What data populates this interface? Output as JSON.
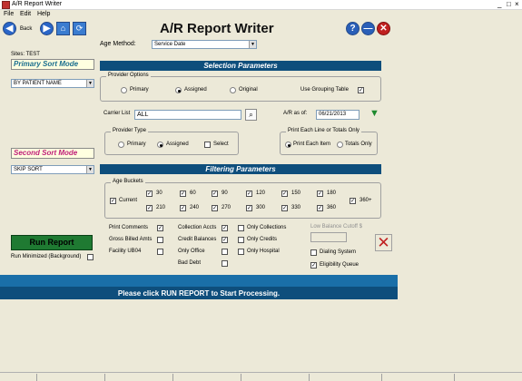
{
  "window": {
    "title": "A/R Report Writer",
    "minimize": "_",
    "maximize": "□",
    "close": "×"
  },
  "menu": [
    "File",
    "Edit",
    "Help"
  ],
  "toolbar": {
    "back_label": "Back",
    "page_title": "A/R Report Writer",
    "help_label": "?",
    "min_label": "—",
    "close_label": "✕"
  },
  "age_method": {
    "label": "Age Method:",
    "value": "Service Date"
  },
  "sites": "Sites: TEST",
  "primary_sort": {
    "title": "Primary Sort Mode",
    "value": "BY PATIENT NAME"
  },
  "second_sort": {
    "title": "Second Sort Mode",
    "value": "SKIP SORT"
  },
  "selection_header": "Selection Parameters",
  "provider_options": {
    "title": "Provider Options",
    "options": [
      "Primary",
      "Assigned",
      "Original"
    ],
    "selected": "Assigned",
    "grouping_label": "Use Grouping Table",
    "grouping_checked": true
  },
  "carrier": {
    "label": "Carrier List",
    "value": "ALL"
  },
  "ar_as_of": {
    "label": "A/R as of:",
    "value": "06/21/2013"
  },
  "provider_type": {
    "title": "Provider Type",
    "options": [
      "Primary",
      "Assigned"
    ],
    "selected": "Assigned",
    "select_label": "Select"
  },
  "print_each": {
    "title": "Print Each Line or Totals Only",
    "options": [
      "Print Each Item",
      "Totals Only"
    ],
    "selected": "Print Each Item"
  },
  "filtering_header": "Filtering Parameters",
  "age_buckets": {
    "title": "Age Buckets",
    "current": "Current",
    "row1": [
      "30",
      "60",
      "90",
      "120",
      "150",
      "180"
    ],
    "row2": [
      "210",
      "240",
      "270",
      "300",
      "330",
      "360"
    ],
    "extra": "360+"
  },
  "options_left": [
    {
      "label": "Print Comments",
      "checked": true
    },
    {
      "label": "Gross Billed Amts",
      "checked": false
    },
    {
      "label": "Facility UB04",
      "checked": false
    }
  ],
  "options_mid": [
    {
      "label": "Collection Accts",
      "checked": true
    },
    {
      "label": "Credit Balances",
      "checked": true
    },
    {
      "label": "Only Office",
      "checked": false
    },
    {
      "label": "Bad Debt",
      "checked": false
    }
  ],
  "options_right": [
    {
      "label": "Only Collections",
      "checked": false
    },
    {
      "label": "Only Credits",
      "checked": false
    },
    {
      "label": "Only Hospital",
      "checked": false
    }
  ],
  "low_balance": {
    "label": "Low Balance Cutoff $",
    "value": ""
  },
  "dialing": {
    "label": "Dialing System",
    "checked": false
  },
  "eligibility": {
    "label": "Eligibility Queue",
    "checked": true
  },
  "run_report": {
    "label": "Run Report",
    "minimized_label": "Run Minimized (Background)"
  },
  "bottom_message": "Please click RUN REPORT to Start Processing.",
  "colors": {
    "section_bar": "#0e4e7c",
    "run_button": "#1f7a32",
    "primary_sort_text": "#1a6e8e",
    "second_sort_text": "#c0207a"
  }
}
